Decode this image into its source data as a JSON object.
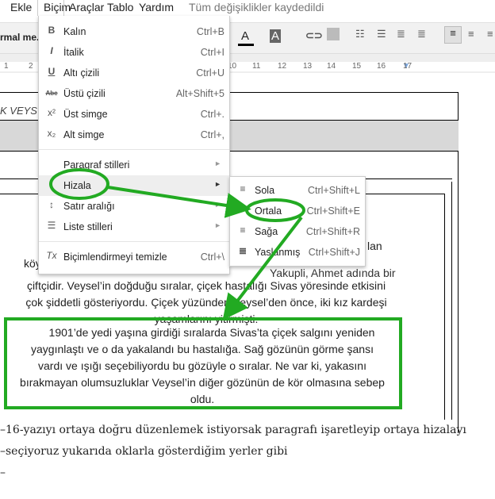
{
  "menubar": {
    "items": [
      "Ekle",
      "Biçim",
      "Araçlar",
      "Tablo",
      "Yardım"
    ],
    "status": "Tüm değişiklikler kaydedildi"
  },
  "toolbar": {
    "style": "rmal me...",
    "text_color": "A",
    "highlight": "A"
  },
  "ruler": [
    "1",
    "2",
    "9",
    "10",
    "11",
    "12",
    "13",
    "14",
    "15",
    "16",
    "17"
  ],
  "menu": [
    {
      "icon": "bold-icon",
      "glyph": "B",
      "label": "Kalın",
      "shortcut": "Ctrl+B"
    },
    {
      "icon": "italic-icon",
      "glyph": "I",
      "label": "İtalik",
      "shortcut": "Ctrl+I"
    },
    {
      "icon": "underline-icon",
      "glyph": "U",
      "label": "Altı çizili",
      "shortcut": "Ctrl+U"
    },
    {
      "icon": "strikethrough-icon",
      "glyph": "Abc",
      "label": "Üstü çizili",
      "shortcut": "Alt+Shift+5"
    },
    {
      "icon": "superscript-icon",
      "glyph": "x²",
      "label": "Üst simge",
      "shortcut": "Ctrl+."
    },
    {
      "icon": "subscript-icon",
      "glyph": "x₂",
      "label": "Alt simge",
      "shortcut": "Ctrl+,"
    },
    {
      "label": "Paragraf stilleri",
      "submenu": true
    },
    {
      "label": "Hizala",
      "submenu": true
    },
    {
      "icon": "line-spacing-icon",
      "glyph": "↕",
      "label": "Satır aralığı",
      "submenu": true
    },
    {
      "icon": "list-icon",
      "glyph": "☰",
      "label": "Liste stilleri",
      "submenu": true
    },
    {
      "icon": "clear-formatting-icon",
      "glyph": "Tx",
      "label": "Biçimlendirmeyi temizle",
      "shortcut": "Ctrl+\\"
    }
  ],
  "submenu": [
    {
      "label": "Sola",
      "shortcut": "Ctrl+Shift+L"
    },
    {
      "label": "Ortala",
      "shortcut": "Ctrl+Shift+E"
    },
    {
      "label": "Sağa",
      "shortcut": "Ctrl+Shift+R"
    },
    {
      "label": "Yaslanmış",
      "shortcut": "Ctrl+Shift+J"
    }
  ],
  "doc": {
    "header_fragment": "K VEYS",
    "para1_fragments": [
      "lan",
      "köy",
      "Yakupli, Ahmet adında bir"
    ],
    "para1": [
      "çiftçidir. Veysel’in doğduğu sıralar, çiçek hastalığı Sivas yöresinde etkisini",
      "çok şiddetli gösteriyordu. Çiçek yüzünden Veysel’den önce, iki kız kardeşi",
      "yaşamlarını yitirmişti."
    ],
    "para2": [
      "1901’de yedi yaşına girdiği sıralarda Sivas’ta çiçek salgını yeniden",
      "yaygınlaştı ve o da yakalandı bu hastalığa. Sağ gözünün görme şansı",
      "vardı ve ışığı seçebiliyordu bu gözüyle o sıralar. Ne var ki, yakasını",
      "bırakmayan olumsuzluklar Veysel’in diğer gözünün de kör olmasına sebep",
      "oldu."
    ]
  },
  "notes": [
    "–16-yazıyı ortaya doğru düzenlemek istiyorsak paragrafı işaretleyip ortaya hizalayı",
    "–seçiyoruz yukarıda oklarla gösterdiğim yerler gibi",
    "–"
  ],
  "colors": {
    "annotation": "#22aa22",
    "menu_hover": "#eeeeee"
  }
}
